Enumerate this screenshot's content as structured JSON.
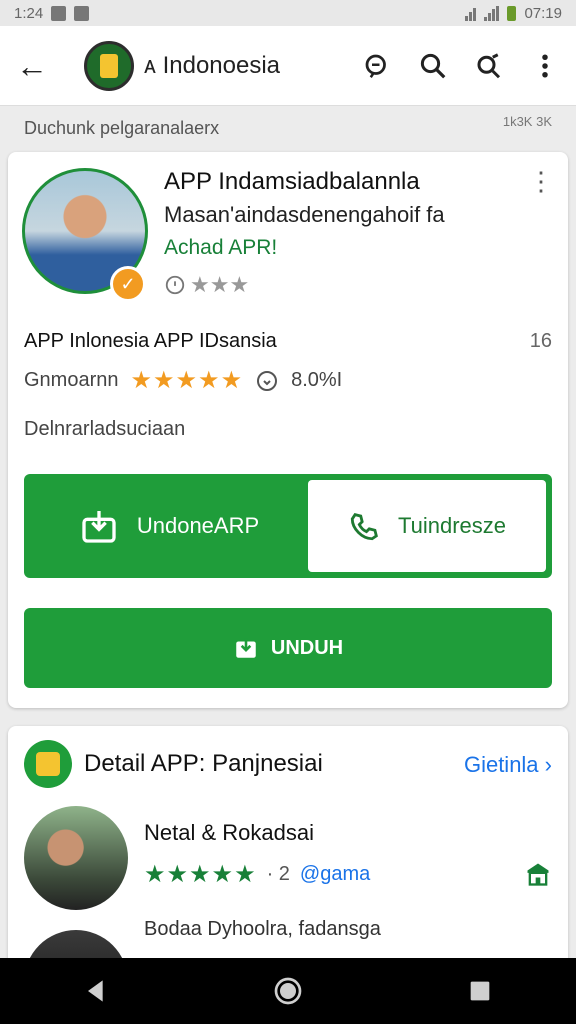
{
  "status_bar": {
    "time": "1:24",
    "clock": "07:19"
  },
  "app_bar": {
    "title": "ᴀ Indonoesia"
  },
  "subheader": {
    "text": "Duchunk pelgaranalaerx",
    "count": "1k3K 3K"
  },
  "app_card": {
    "title": "APP Indamsiadbalannla",
    "subtitle": "Masan'aindasdenengahoif fa",
    "green_text": "Achad APR!",
    "rating_stars": "★★★",
    "row1_label": "APP Inlonesia APP IDsansia",
    "row1_value": "16",
    "row2_label": "Gnmoarnn",
    "row2_stars": "★★★★★",
    "row2_value": "8.0%I",
    "row3_text": "Delnrarladsuciaan",
    "button_left": "UndoneARP",
    "button_right": "Tuindresze",
    "button_full": "UNDUH"
  },
  "detail_card": {
    "title": "Detail APP: Panjnesiai",
    "link": "Gietinla ›",
    "item_name": "Netal & Rokadsai",
    "item_stars": "★★★★★",
    "item_sep": "· 2",
    "item_tag": "@gama",
    "item_desc": "Bodaa  Dyhoolra, fadansga"
  },
  "colors": {
    "primary_green": "#1f9d3a",
    "accent_orange": "#f29b21",
    "link_blue": "#1a73e8"
  }
}
